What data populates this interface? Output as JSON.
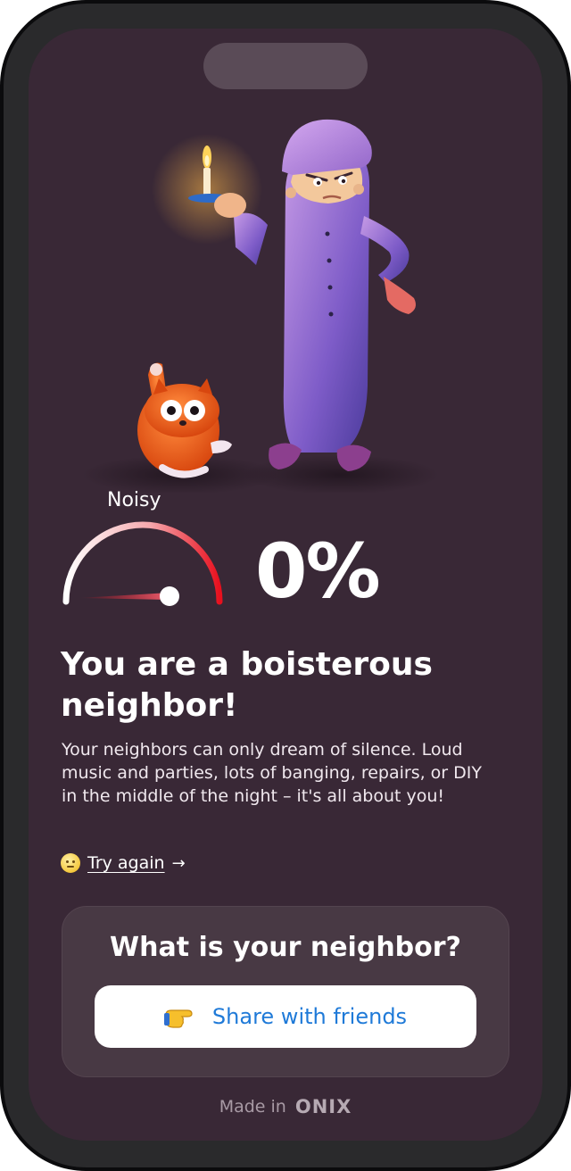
{
  "gauge": {
    "label": "Noisy",
    "level": 0
  },
  "result": {
    "percent": "0%",
    "headline": "You are a boisterous neighbor!",
    "description": "Your neighbors can only dream of silence. Loud music and parties, lots of banging, repairs, or DIY in the middle of the night – it's all about you!"
  },
  "actions": {
    "try_again_label": "Try again",
    "try_again_arrow": "→",
    "try_again_icon": "neutral-face-emoji"
  },
  "share_card": {
    "title": "What is your neighbor?",
    "button_label": "Share with friends",
    "button_icon": "pointing-hand-emoji"
  },
  "footer": {
    "made_in": "Made in",
    "brand": "ONIX"
  },
  "colors": {
    "background": "#392836",
    "card": "#483944",
    "gauge_red": "#e8101e",
    "share_text": "#1f7ad8"
  }
}
